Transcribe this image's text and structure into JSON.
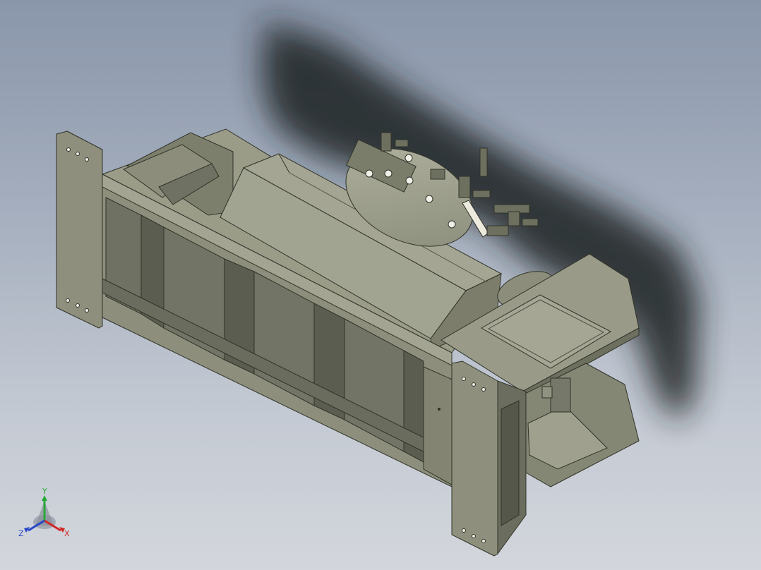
{
  "viewport": {
    "background_top": "#8a96aa",
    "background_bottom": "#d3d6dc"
  },
  "model": {
    "body_color": "#8f917e",
    "dark_color": "#5f6154",
    "light_color": "#a8aa98",
    "shadow_color": "#1c1e22",
    "accent_white": "#ece9dd"
  },
  "triad": {
    "x_label": "X",
    "y_label": "Y",
    "z_label": "Z",
    "x_color": "#d02828",
    "y_color": "#2aa83a",
    "z_color": "#2848c8"
  }
}
